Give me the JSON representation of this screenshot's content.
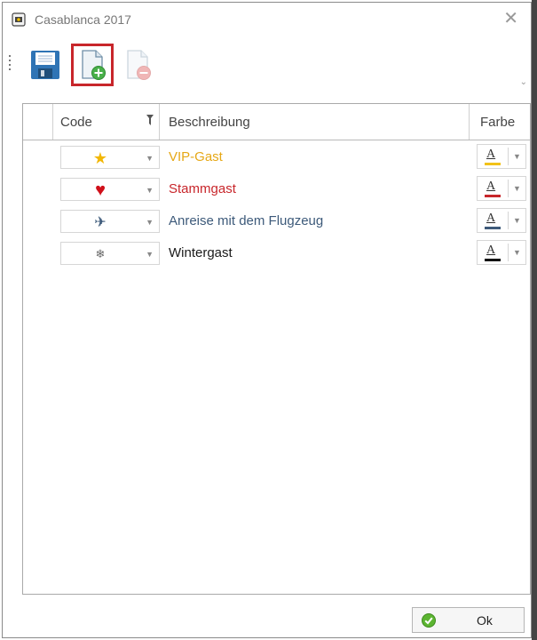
{
  "window": {
    "title": "Casablanca 2017"
  },
  "toolbar": {
    "save_icon": "floppy-disk-icon",
    "add_icon": "new-document-add-icon",
    "remove_icon": "document-remove-icon"
  },
  "grid": {
    "columns": {
      "code": "Code",
      "description": "Beschreibung",
      "color": "Farbe"
    },
    "rows": [
      {
        "code_icon": "star-icon",
        "code_glyph": "★",
        "description": "VIP-Gast",
        "text_color": "#e6a817",
        "color_label": "A",
        "swatch": "#f2c218"
      },
      {
        "code_icon": "heart-icon",
        "code_glyph": "♥",
        "description": "Stammgast",
        "text_color": "#c8262b",
        "color_label": "A",
        "swatch": "#c8262b"
      },
      {
        "code_icon": "airplane-icon",
        "code_glyph": "✈",
        "description": "Anreise mit dem Flugzeug",
        "text_color": "#3d5a7a",
        "color_label": "A",
        "swatch": "#3d5a7a"
      },
      {
        "code_icon": "snowflake-icon",
        "code_glyph": "❄",
        "description": "Wintergast",
        "text_color": "#1a1a1a",
        "color_label": "A",
        "swatch": "#111111"
      }
    ]
  },
  "footer": {
    "ok_label": "Ok"
  }
}
